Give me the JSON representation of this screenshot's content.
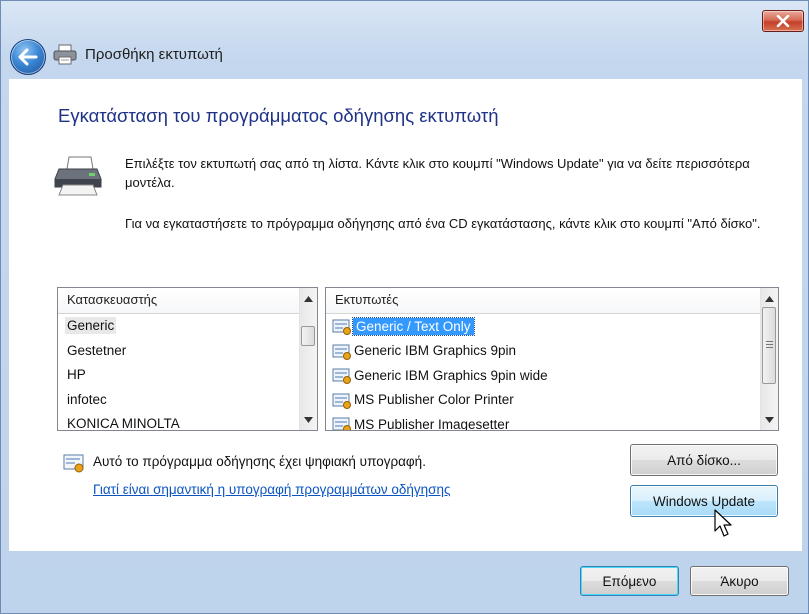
{
  "window": {
    "title": "Προσθήκη εκτυπωτή",
    "close_label": "close"
  },
  "page": {
    "heading": "Εγκατάσταση του προγράμματος οδήγησης εκτυπωτή",
    "instruction_1": "Επιλέξτε τον εκτυπωτή σας από τη λίστα. Κάντε κλικ στο κουμπί \"Windows Update\" για να δείτε περισσότερα μοντέλα.",
    "instruction_2": "Για να εγκαταστήσετε το πρόγραμμα οδήγησης από ένα CD εγκατάστασης, κάντε κλικ στο κουμπί \"Από δίσκο\"."
  },
  "manufacturers": {
    "header": "Κατασκευαστής",
    "selected": "Generic",
    "items": [
      "Generic",
      "Gestetner",
      "HP",
      "infotec",
      "KONICA MINOLTA"
    ]
  },
  "printers": {
    "header": "Εκτυπωτές",
    "selected": "Generic / Text Only",
    "items": [
      "Generic / Text Only",
      "Generic IBM Graphics 9pin",
      "Generic IBM Graphics 9pin wide",
      "MS Publisher Color Printer",
      "MS Publisher Imagesetter"
    ]
  },
  "signature": {
    "status": "Αυτό το πρόγραμμα οδήγησης έχει ψηφιακή υπογραφή.",
    "link": "Γιατί είναι σημαντική η υπογραφή προγραμμάτων οδήγησης"
  },
  "buttons": {
    "have_disk": "Από δίσκο...",
    "windows_update": "Windows Update",
    "next": "Επόμενο",
    "cancel": "Άκυρο"
  },
  "colors": {
    "heading": "#1e3287",
    "link": "#0b54c2",
    "selection": "#3399ff",
    "close_button": "#c4402a"
  },
  "icons": {
    "back": "back-arrow-icon",
    "title": "printer-icon",
    "driver": "printer-icon",
    "signature": "certificate-icon"
  }
}
